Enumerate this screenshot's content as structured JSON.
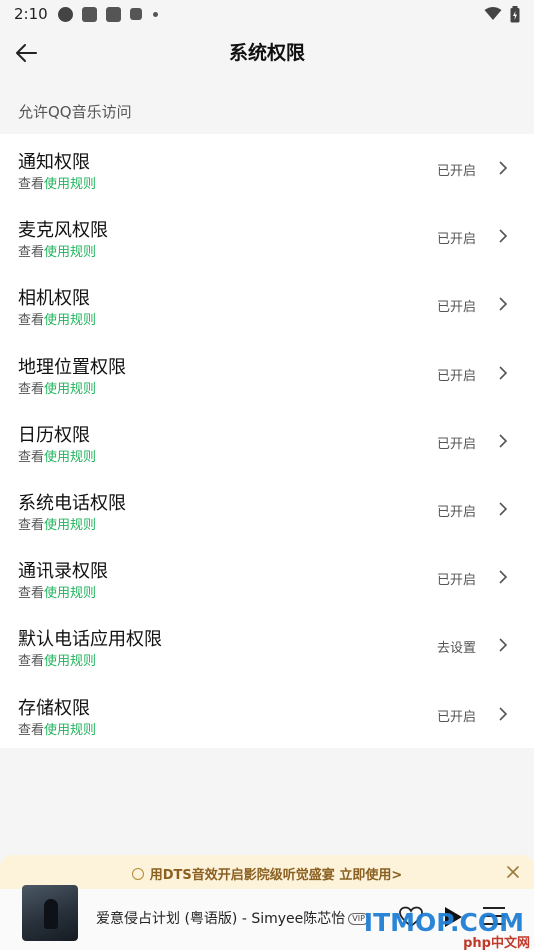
{
  "status_bar": {
    "time": "2:10"
  },
  "header": {
    "title": "系统权限"
  },
  "section_label": "允许QQ音乐访问",
  "permissions": [
    {
      "title": "通知权限",
      "sub_prefix": "查看",
      "sub_link": "使用规则",
      "status": "已开启"
    },
    {
      "title": "麦克风权限",
      "sub_prefix": "查看",
      "sub_link": "使用规则",
      "status": "已开启"
    },
    {
      "title": "相机权限",
      "sub_prefix": "查看",
      "sub_link": "使用规则",
      "status": "已开启"
    },
    {
      "title": "地理位置权限",
      "sub_prefix": "查看",
      "sub_link": "使用规则",
      "status": "已开启"
    },
    {
      "title": "日历权限",
      "sub_prefix": "查看",
      "sub_link": "使用规则",
      "status": "已开启"
    },
    {
      "title": "系统电话权限",
      "sub_prefix": "查看",
      "sub_link": "使用规则",
      "status": "已开启"
    },
    {
      "title": "通讯录权限",
      "sub_prefix": "查看",
      "sub_link": "使用规则",
      "status": "已开启"
    },
    {
      "title": "默认电话应用权限",
      "sub_prefix": "查看",
      "sub_link": "使用规则",
      "status": "去设置"
    },
    {
      "title": "存储权限",
      "sub_prefix": "查看",
      "sub_link": "使用规则",
      "status": "已开启"
    }
  ],
  "banner": {
    "text": "用DTS音效开启影院级听觉盛宴 立即使用>"
  },
  "player": {
    "song": "爱意侵占计划 (粤语版) - Simyee陈芯怡",
    "vip_badge": "VIP"
  },
  "watermark": {
    "main": "ITMOP.COM",
    "sub": "php中文网"
  },
  "colors": {
    "link": "#22b35e",
    "banner_bg": "#fdf2da",
    "banner_text": "#8a6020"
  }
}
